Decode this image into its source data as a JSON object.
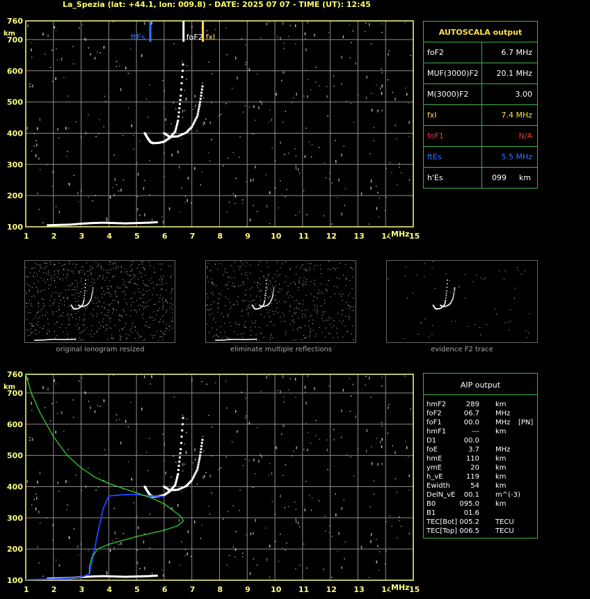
{
  "header": "La_Spezia (lat: +44.1, lon: 009.8) - DATE: 2025 07 07 - TIME (UT): 12:45",
  "colors": {
    "grid": "#8c8c8c",
    "axis": "#ffff80",
    "trace": "#ffffff",
    "fes": "#2f78ff",
    "fxl": "#ffe14a",
    "profile": "#2fd02f",
    "blue_profile": "#2040ff",
    "table_border": "#3cb44a",
    "foF1": "#ff3030"
  },
  "axes": {
    "freq_unit": "MHz",
    "height_unit": "km",
    "x_ticks": [
      "1",
      "2",
      "3",
      "4",
      "5",
      "6",
      "7",
      "8",
      "9",
      "10",
      "11",
      "12",
      "13",
      "14",
      "15"
    ],
    "y_ticks": [
      "100",
      "200",
      "300",
      "400",
      "500",
      "600",
      "700",
      "760"
    ],
    "xlim": [
      1,
      15
    ],
    "ylim": [
      100,
      760
    ]
  },
  "markers": {
    "ftEs_label": "ftEs",
    "foF2_label": "foF2",
    "fxI_label": "fxI",
    "ftEs_freq": 5.5,
    "foF2_freq": 6.7,
    "fxI_freq": 7.4
  },
  "autoscala": {
    "title": "AUTOSCALA output",
    "rows": [
      {
        "name": "foF2",
        "value": "6.7 MHz",
        "color": "#ffffff"
      },
      {
        "name": "MUF(3000)F2",
        "value": "20.1 MHz",
        "color": "#ffffff"
      },
      {
        "name": "M(3000)F2",
        "value": "3.00",
        "color": "#ffffff"
      },
      {
        "name": "fxI",
        "value": "7.4 MHz",
        "color": "#ffe14a"
      },
      {
        "name": "foF1",
        "value": "N/A",
        "color": "#ff3030"
      },
      {
        "name": "ftEs",
        "value": "5.5 MHz",
        "color": "#2f78ff"
      },
      {
        "name": "h'Es",
        "value": "099",
        "unit": "km",
        "color": "#ffffff"
      }
    ]
  },
  "thumbnails": [
    {
      "caption": "original ionogram resized"
    },
    {
      "caption": "eliminate multiple reflections"
    },
    {
      "caption": "evidence F2 trace"
    }
  ],
  "aip": {
    "title": "AIP output",
    "rows": [
      [
        "hmF2",
        "289",
        "km",
        ""
      ],
      [
        "foF2",
        "06.7",
        "MHz",
        ""
      ],
      [
        "foF1",
        "00.0",
        "MHz",
        "[PN]"
      ],
      [
        "hmF1",
        "---",
        "km",
        ""
      ],
      [
        "D1",
        "00.0",
        "",
        ""
      ],
      [
        "foE",
        "3.7",
        "MHz",
        ""
      ],
      [
        "hmE",
        "110",
        "km",
        ""
      ],
      [
        "ymE",
        "20",
        "km",
        ""
      ],
      [
        "h_vE",
        "119",
        "km",
        ""
      ],
      [
        "Ewidth",
        "54",
        "km",
        ""
      ],
      [
        "DelN_vE",
        "00.1",
        "m^(-3)",
        ""
      ],
      [
        "B0",
        "095.0",
        "km",
        ""
      ],
      [
        "B1",
        "01.6",
        "",
        ""
      ],
      [
        "TEC[Bot]",
        "005.2",
        "TECU",
        ""
      ],
      [
        "TEC[Top]",
        "006.5",
        "TECU",
        ""
      ]
    ]
  },
  "chart_data": [
    {
      "type": "scatter",
      "title": "",
      "xlabel": "MHz",
      "ylabel": "km",
      "xlim": [
        1,
        15
      ],
      "ylim": [
        100,
        760
      ],
      "series": [
        {
          "name": "E/Es trace",
          "x": [
            1.8,
            2.2,
            2.6,
            3.0,
            3.4,
            3.8,
            4.2,
            4.6,
            5.0,
            5.4,
            5.8
          ],
          "y": [
            105,
            106,
            107,
            110,
            112,
            113,
            112,
            111,
            112,
            113,
            115
          ]
        },
        {
          "name": "F2 o-trace",
          "x": [
            5.3,
            5.4,
            5.5,
            5.6,
            5.8,
            6.0,
            6.2,
            6.4,
            6.5,
            6.6,
            6.7
          ],
          "y": [
            400,
            385,
            372,
            368,
            369,
            373,
            385,
            405,
            440,
            520,
            640
          ]
        },
        {
          "name": "F2 x-trace",
          "x": [
            6.0,
            6.2,
            6.5,
            6.8,
            7.0,
            7.2,
            7.3,
            7.4
          ],
          "y": [
            400,
            388,
            390,
            402,
            420,
            455,
            500,
            560
          ]
        }
      ]
    },
    {
      "type": "line",
      "title": "",
      "xlabel": "MHz",
      "ylabel": "km",
      "xlim": [
        1,
        15
      ],
      "ylim": [
        100,
        760
      ],
      "series": [
        {
          "x": [
            1.0,
            1.2,
            1.5,
            2.0,
            2.5,
            3.0,
            3.5,
            4.0,
            4.5,
            5.0,
            5.5,
            6.0,
            6.3,
            6.6,
            6.7,
            6.5,
            6.0,
            5.0,
            4.0,
            3.6,
            3.4,
            3.3,
            3.3
          ],
          "y": [
            760,
            700,
            640,
            560,
            500,
            460,
            430,
            410,
            395,
            380,
            365,
            345,
            325,
            305,
            290,
            275,
            260,
            240,
            215,
            200,
            175,
            145,
            120
          ]
        },
        {
          "x": [
            1.0,
            1.5,
            2.0,
            2.5,
            3.0,
            3.3,
            3.6,
            3.8,
            4.0,
            4.5,
            5.0,
            5.5,
            6.0
          ],
          "y": [
            102,
            103,
            104,
            106,
            110,
            120,
            250,
            330,
            370,
            374,
            375,
            370,
            368
          ]
        }
      ]
    }
  ]
}
